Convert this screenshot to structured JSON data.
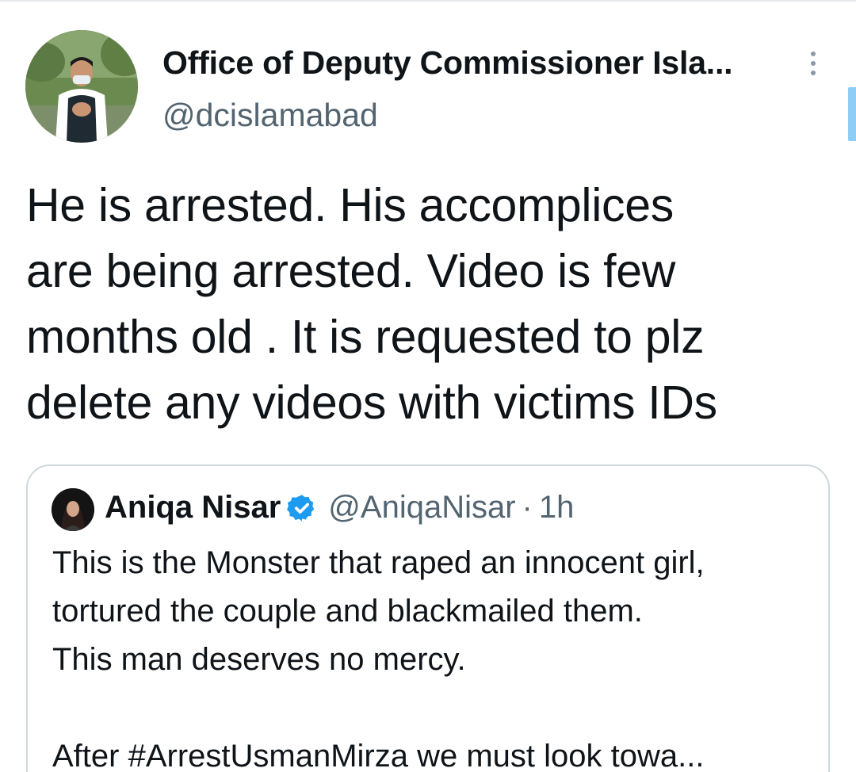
{
  "tweet": {
    "author_name": "Office of Deputy Commissioner Isla...",
    "author_handle": "@dcislamabad",
    "text_lines": [
      "He is arrested.  His accomplices",
      "are being arrested.  Video is few",
      "months old . It is requested to plz",
      "delete any videos with victims IDs"
    ]
  },
  "quote": {
    "author_name": "Aniqa Nisar",
    "author_handle": "@AniqaNisar",
    "separator": "·",
    "time": "1h",
    "text_lines": [
      "This is the Monster that raped an innocent girl,",
      "tortured the couple and blackmailed them.",
      "This man deserves no mercy.",
      "",
      "After #ArrestUsmanMirza we must look towa..."
    ]
  },
  "icons": {
    "more": "more-vertical-icon",
    "verified": "verified-badge-icon"
  },
  "colors": {
    "text_primary": "#0f1419",
    "text_secondary": "#536471",
    "verified_blue": "#1d9bf0",
    "border": "#cfd9de"
  }
}
